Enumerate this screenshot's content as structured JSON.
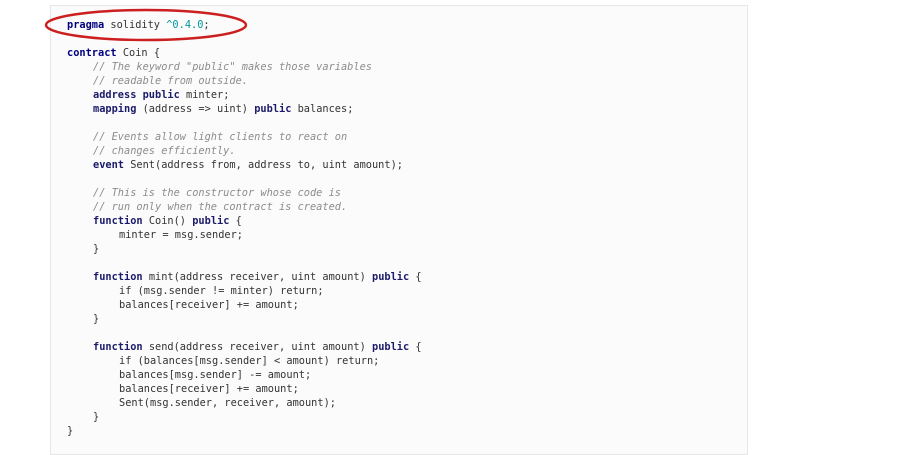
{
  "code": {
    "pragma": {
      "kw": "pragma",
      "name": "solidity",
      "version": "^0.4.0",
      "semi": ";"
    },
    "contract_decl": {
      "kw": "contract",
      "name": "Coin",
      "brace": "{"
    },
    "comment1": [
      "// The keyword \"public\" makes those variables",
      "// readable from outside."
    ],
    "var_minter": {
      "type": "address",
      "kw": "public",
      "name": "minter;"
    },
    "var_balances": {
      "type": "mapping",
      "mapping": "(address => uint)",
      "kw": "public",
      "name": "balances;"
    },
    "comment2": [
      "// Events allow light clients to react on",
      "// changes efficiently."
    ],
    "event_decl": {
      "kw": "event",
      "rest": "Sent(address from, address to, uint amount);"
    },
    "comment3": [
      "// This is the constructor whose code is",
      "// run only when the contract is created."
    ],
    "constructor": {
      "kw": "function",
      "sig": "Coin()",
      "kw2": "public",
      "brace": "{"
    },
    "constructor_body": "minter = msg.sender;",
    "close_brace": "}",
    "mint": {
      "kw": "function",
      "sig": "mint(address receiver, uint amount)",
      "kw2": "public",
      "brace": "{"
    },
    "mint_body": [
      "if (msg.sender != minter) return;",
      "balances[receiver] += amount;"
    ],
    "send": {
      "kw": "function",
      "sig": "send(address receiver, uint amount)",
      "kw2": "public",
      "brace": "{"
    },
    "send_body": [
      "if (balances[msg.sender] < amount) return;",
      "balances[msg.sender] -= amount;",
      "balances[receiver] += amount;",
      "Sent(msg.sender, receiver, amount);"
    ]
  },
  "annotation": {
    "shape": "ellipse",
    "color": "#cc1f1f",
    "target": "pragma-line"
  }
}
